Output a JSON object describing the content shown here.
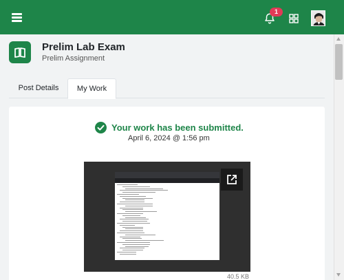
{
  "topbar": {
    "menu_icon": "hamburger-icon",
    "notifications": {
      "icon": "bell-icon",
      "count": "1"
    },
    "apps_icon": "grid-icon",
    "avatar_icon": "user-avatar"
  },
  "header": {
    "icon": "book-icon",
    "title": "Prelim Lab Exam",
    "subtitle": "Prelim Assignment"
  },
  "tabs": [
    {
      "label": "Post Details",
      "active": false
    },
    {
      "label": "My Work",
      "active": true
    }
  ],
  "submission": {
    "status_icon": "check-circle-icon",
    "status_text": "Your work has been submitted.",
    "date": "April 6, 2024 @ 1:56 pm",
    "attachment": {
      "open_icon": "external-link-icon",
      "size": "40.5 KB"
    }
  },
  "colors": {
    "brand": "#1e8549",
    "badge": "#e03a57"
  }
}
